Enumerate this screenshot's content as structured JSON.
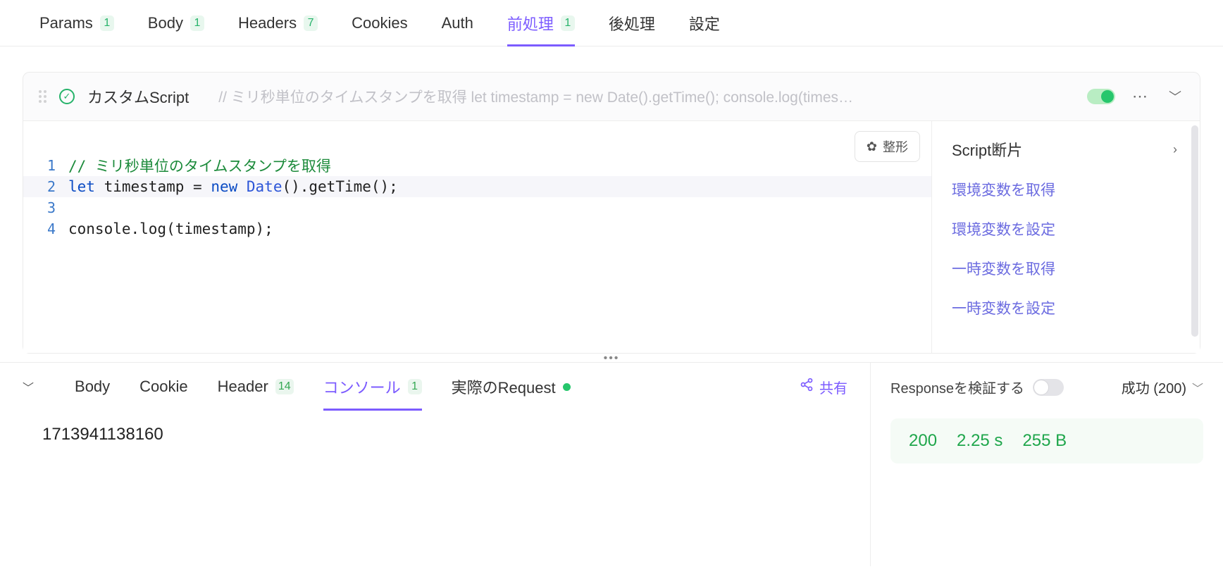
{
  "tabs": {
    "params": {
      "label": "Params",
      "count": "1"
    },
    "body": {
      "label": "Body",
      "count": "1"
    },
    "headers": {
      "label": "Headers",
      "count": "7"
    },
    "cookies": {
      "label": "Cookies"
    },
    "auth": {
      "label": "Auth"
    },
    "pre": {
      "label": "前処理",
      "count": "1"
    },
    "post": {
      "label": "後処理"
    },
    "settings": {
      "label": "設定"
    }
  },
  "script": {
    "title": "カスタムScript",
    "preview": "// ミリ秒単位のタイムスタンプを取得 let timestamp = new Date().getTime(); console.log(times…",
    "format_label": "整形",
    "lines": {
      "l1_comment": "// ミリ秒単位のタイムスタンプを取得",
      "l2_let": "let",
      "l2_ident": " timestamp = ",
      "l2_new": "new",
      "l2_date": " Date",
      "l2_rest": "().getTime();",
      "l4": "console.log(timestamp);"
    }
  },
  "snippets": {
    "title": "Script断片",
    "items": [
      "環境変数を取得",
      "環境変数を設定",
      "一時変数を取得",
      "一時変数を設定"
    ]
  },
  "response": {
    "tabs": {
      "body": {
        "label": "Body"
      },
      "cookie": {
        "label": "Cookie"
      },
      "header": {
        "label": "Header",
        "count": "14"
      },
      "console": {
        "label": "コンソール",
        "count": "1"
      },
      "actual": {
        "label": "実際のRequest"
      }
    },
    "share_label": "共有",
    "console_output": "1713941138160",
    "verify_label": "Responseを検証する",
    "status_text": "成功 (200)",
    "metrics": {
      "code": "200",
      "time": "2.25 s",
      "size": "255 B"
    }
  }
}
